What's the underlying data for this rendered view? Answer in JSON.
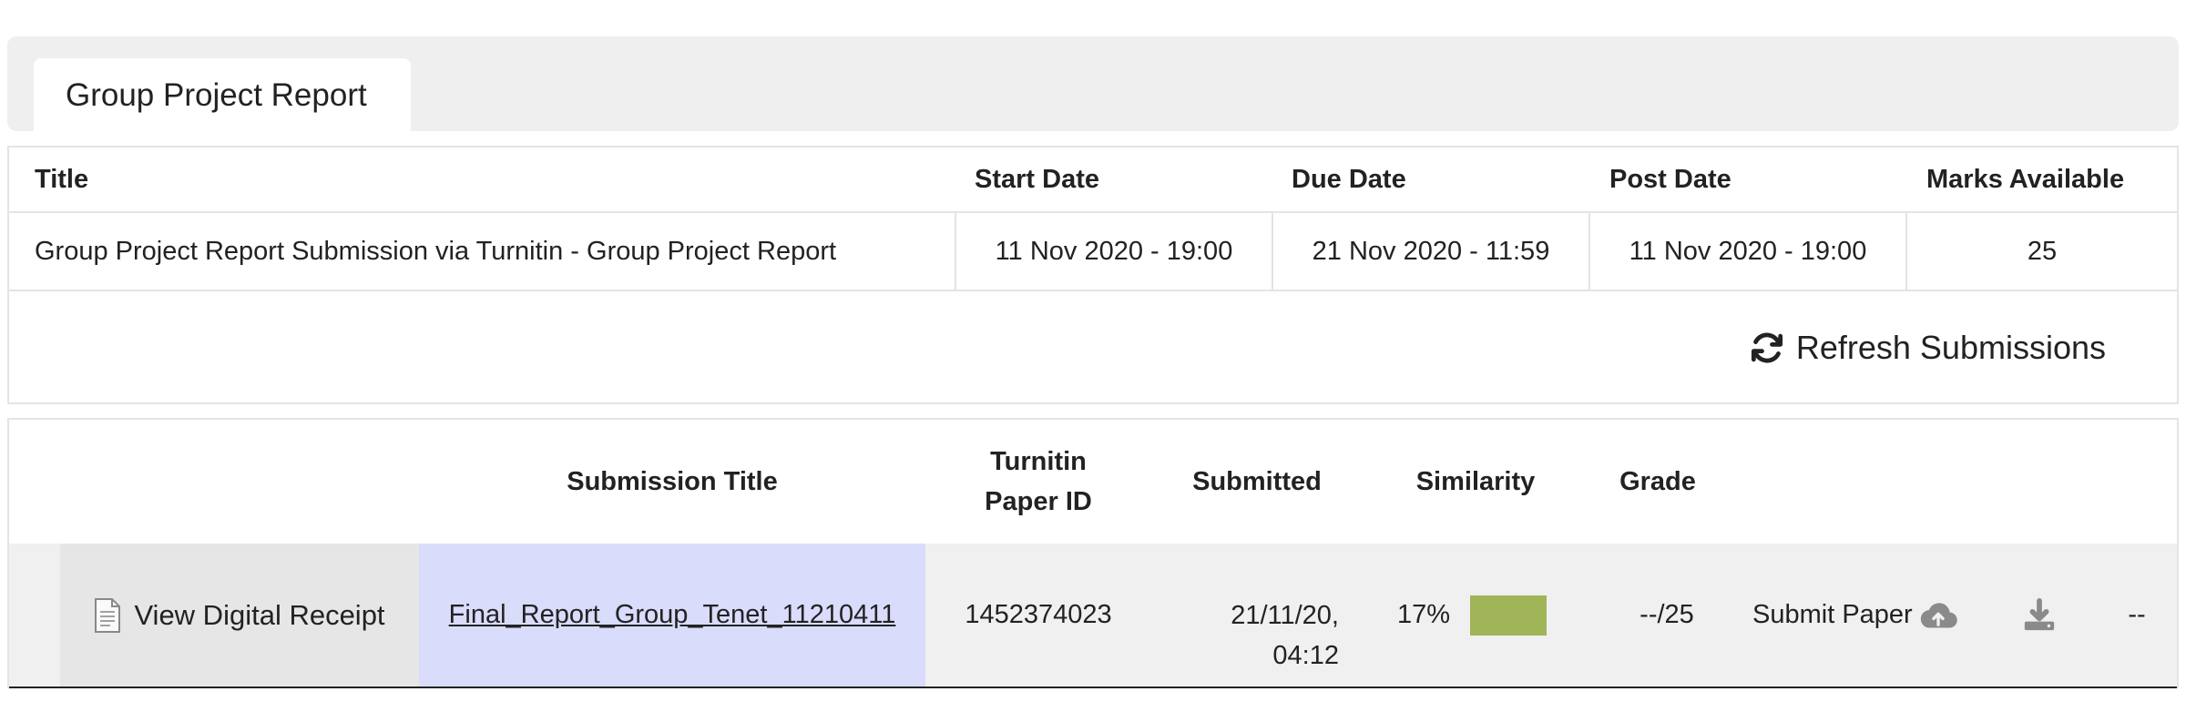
{
  "tab": {
    "label": "Group Project Report"
  },
  "assignment": {
    "headers": {
      "title": "Title",
      "start": "Start Date",
      "due": "Due Date",
      "post": "Post Date",
      "marks": "Marks Available"
    },
    "row": {
      "title": "Group Project Report Submission via Turnitin - Group Project Report",
      "start": "11 Nov 2020 - 19:00",
      "due": "21 Nov 2020 - 11:59",
      "post": "11 Nov 2020 - 19:00",
      "marks": "25"
    }
  },
  "refresh": {
    "label": "Refresh Submissions",
    "icon": "refresh-icon"
  },
  "submissions": {
    "headers": {
      "title": "Submission Title",
      "paper_id_line1": "Turnitin",
      "paper_id_line2": "Paper ID",
      "submitted": "Submitted",
      "similarity": "Similarity",
      "grade": "Grade"
    },
    "row": {
      "receipt_label": "View Digital Receipt",
      "receipt_icon": "document-icon",
      "title": "Final_Report_Group_Tenet_11210411",
      "paper_id": "1452374023",
      "submitted_line1": "21/11/20,",
      "submitted_line2": "04:12",
      "similarity": "17%",
      "similarity_color": "#a0b458",
      "grade": "--/25",
      "submit_label": "Submit Paper",
      "submit_icon": "cloud-upload-icon",
      "download_icon": "download-icon",
      "last": "--"
    }
  }
}
